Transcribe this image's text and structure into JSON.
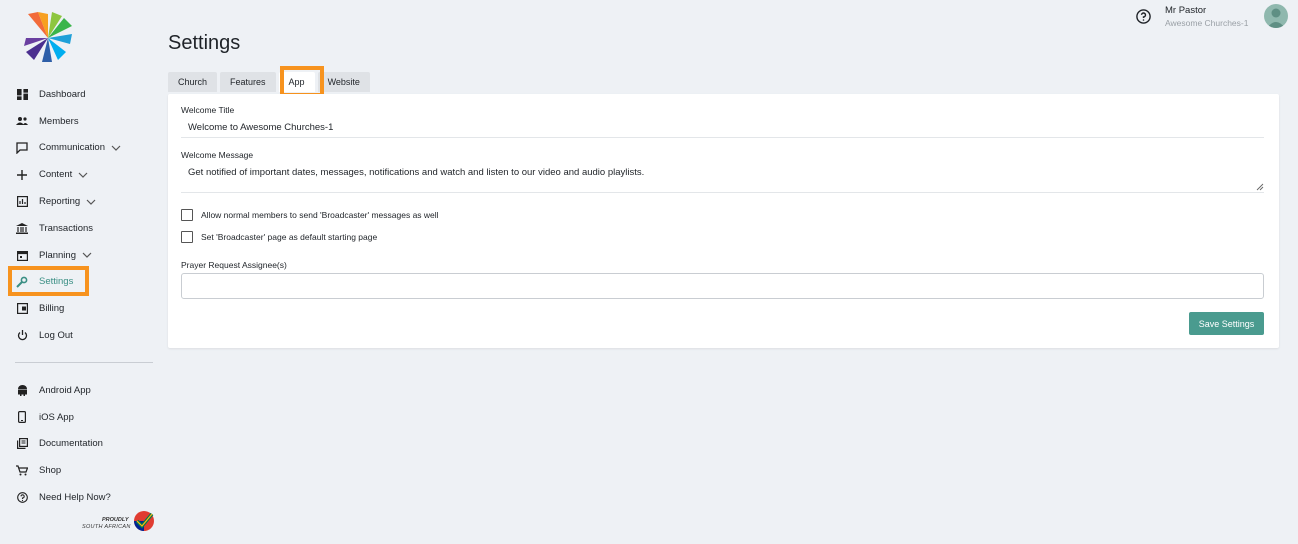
{
  "header": {
    "user_name": "Mr Pastor",
    "user_org": "Awesome Churches-1"
  },
  "page": {
    "title": "Settings"
  },
  "sidebar": {
    "items": [
      {
        "label": "Dashboard",
        "icon": "dashboard-icon"
      },
      {
        "label": "Members",
        "icon": "members-icon"
      },
      {
        "label": "Communication",
        "icon": "chat-icon"
      },
      {
        "label": "Content",
        "icon": "plus-icon"
      },
      {
        "label": "Reporting",
        "icon": "report-icon"
      },
      {
        "label": "Transactions",
        "icon": "bank-icon"
      },
      {
        "label": "Planning",
        "icon": "calendar-icon"
      },
      {
        "label": "Settings",
        "icon": "wrench-icon"
      },
      {
        "label": "Billing",
        "icon": "billing-icon"
      },
      {
        "label": "Log Out",
        "icon": "power-icon"
      }
    ],
    "secondary": [
      {
        "label": "Android App",
        "icon": "android-icon"
      },
      {
        "label": "iOS App",
        "icon": "phone-icon"
      },
      {
        "label": "Documentation",
        "icon": "docs-icon"
      },
      {
        "label": "Shop",
        "icon": "cart-icon"
      },
      {
        "label": "Need Help Now?",
        "icon": "help-icon"
      }
    ],
    "badge_line1": "PROUDLY",
    "badge_line2": "SOUTH AFRICAN"
  },
  "tabs": [
    {
      "label": "Church"
    },
    {
      "label": "Features"
    },
    {
      "label": "App"
    },
    {
      "label": "Website"
    }
  ],
  "form": {
    "welcome_title_label": "Welcome Title",
    "welcome_title_value": "Welcome to Awesome Churches-1",
    "welcome_message_label": "Welcome Message",
    "welcome_message_value": "Get notified of important dates, messages, notifications and watch and listen to our video and audio playlists.",
    "checkbox1_label": "Allow normal members to send 'Broadcaster' messages as well",
    "checkbox2_label": "Set 'Broadcaster' page as default starting page",
    "prayer_label": "Prayer Request Assignee(s)",
    "prayer_value": "",
    "save_label": "Save Settings"
  },
  "colors": {
    "accent": "#4a9b8f",
    "highlight": "#f7931e",
    "background": "#eef1f5"
  }
}
